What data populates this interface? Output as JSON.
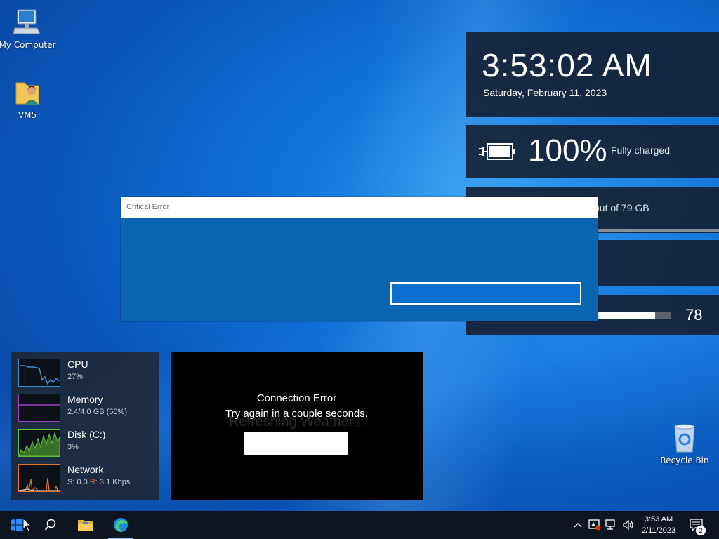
{
  "desktop": {
    "icons": [
      {
        "label": "My Computer",
        "icon": "computer-icon"
      },
      {
        "label": "VM5",
        "icon": "user-folder-icon"
      },
      {
        "label": "Recycle Bin",
        "icon": "recycle-bin-icon"
      }
    ]
  },
  "clock_gadget": {
    "time": "3:53:02 AM",
    "date": "Saturday, February 11, 2023"
  },
  "battery_gadget": {
    "percent": "100%",
    "status": "Fully charged",
    "icon": "battery-charging-icon"
  },
  "storage_gadget": {
    "text": "out of 79 GB"
  },
  "volume_gadget": {
    "value": "78",
    "level": 0.78
  },
  "dialog": {
    "title": "Critical Error"
  },
  "perf_gadget": {
    "cpu": {
      "name": "CPU",
      "value": "27%"
    },
    "memory": {
      "name": "Memory",
      "value": "2.4/4.0 GB (60%)"
    },
    "disk": {
      "name": "Disk (C:)",
      "value": "3%"
    },
    "network": {
      "name": "Network",
      "send_label": "S:",
      "send_value": "0.0",
      "recv_label": "R:",
      "recv_value": "3.1 Kbps"
    }
  },
  "weather_gadget": {
    "background_text": "Refreshing Weather...",
    "title": "Connection Error",
    "message": "Try again in a couple seconds."
  },
  "taskbar": {
    "pinned": [
      "start-icon",
      "search-icon",
      "file-explorer-icon",
      "edge-icon"
    ],
    "tray_time": "3:53 AM",
    "tray_date": "2/11/2023",
    "notification_count": "2"
  },
  "colors": {
    "dialog_blue": "#0a64b0",
    "cpu_graph": "#3a8fd8",
    "memory_graph": "#a040c8",
    "disk_graph": "#5cc038",
    "network_graph": "#e0782a"
  }
}
